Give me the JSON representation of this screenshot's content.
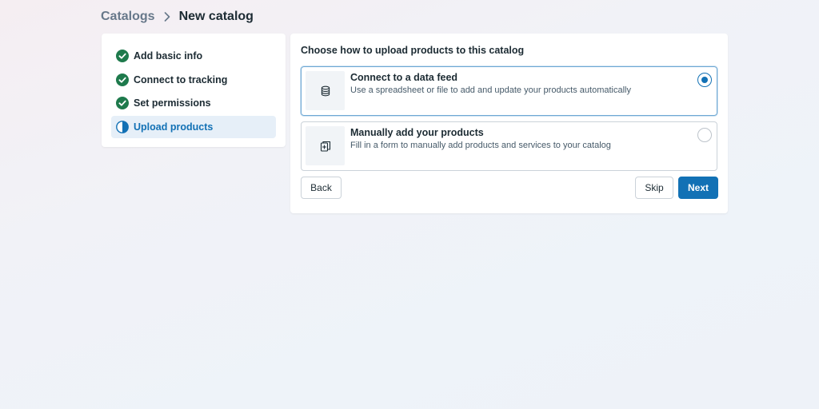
{
  "breadcrumb": {
    "parent": "Catalogs",
    "current": "New catalog"
  },
  "steps": [
    {
      "label": "Add basic info",
      "status": "complete",
      "icon": "check-circle-icon"
    },
    {
      "label": "Connect to tracking",
      "status": "complete",
      "icon": "check-circle-icon"
    },
    {
      "label": "Set permissions",
      "status": "complete",
      "icon": "check-circle-icon"
    },
    {
      "label": "Upload products",
      "status": "in-progress",
      "icon": "half-circle-icon"
    }
  ],
  "main": {
    "title": "Choose how to upload products to this catalog",
    "options": [
      {
        "title": "Connect to a data feed",
        "description": "Use a spreadsheet or file to add and update your products automatically",
        "icon": "database-icon",
        "selected": true
      },
      {
        "title": "Manually add your products",
        "description": "Fill in a form to manually add products and services to your catalog",
        "icon": "add-product-icon",
        "selected": false
      }
    ],
    "buttons": {
      "back": "Back",
      "skip": "Skip",
      "next": "Next"
    }
  },
  "colors": {
    "accent": "#1271b5",
    "complete_green": "#1e7a4c",
    "active_step_bg": "#e6eff8"
  }
}
